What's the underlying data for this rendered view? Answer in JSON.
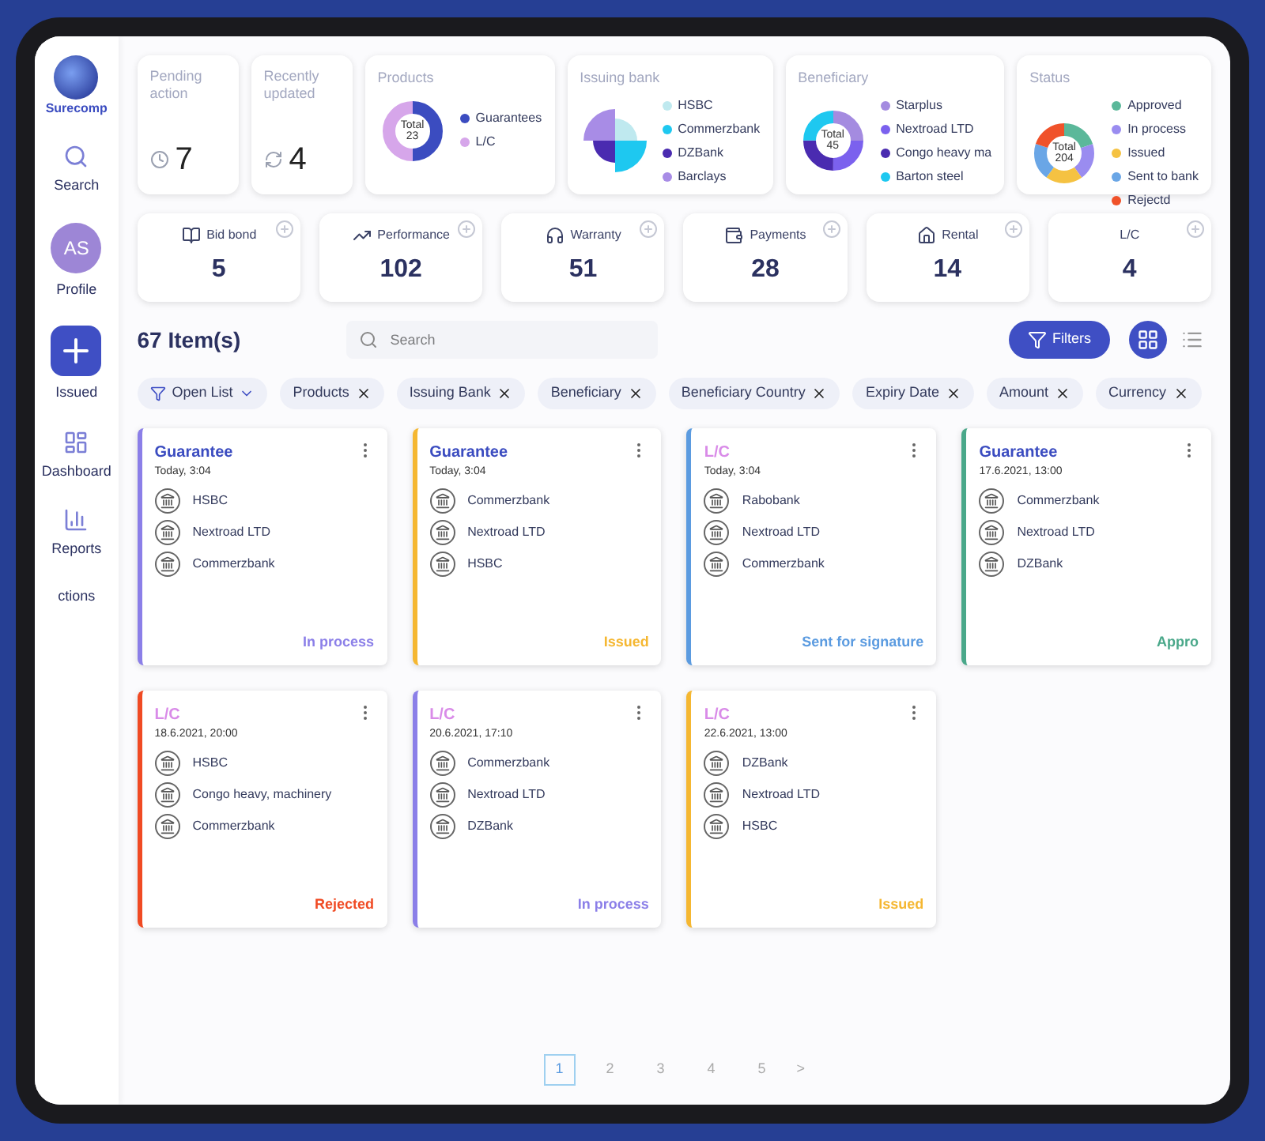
{
  "sidebar": {
    "logo": "Surecomp",
    "items": [
      {
        "kind": "search",
        "label": "Search"
      },
      {
        "kind": "avatar",
        "label": "Profile",
        "initials": "AS"
      },
      {
        "kind": "add",
        "label": "Issued"
      },
      {
        "kind": "dashboard",
        "label": "Dashboard"
      },
      {
        "kind": "reports",
        "label": "Reports"
      },
      {
        "kind": "plain",
        "label": "ctions"
      }
    ]
  },
  "summary": [
    {
      "kind": "pending",
      "title": "Pending action",
      "value": "7"
    },
    {
      "kind": "recent",
      "title": "Recently updated",
      "value": "4"
    },
    {
      "kind": "donut",
      "title": "Products",
      "total_label": "Total",
      "total": "23",
      "legend": [
        {
          "label": "Guarantees",
          "color": "#3b4cc0"
        },
        {
          "label": "L/C",
          "color": "#d6a6ea"
        }
      ]
    },
    {
      "kind": "pie",
      "title": "Issuing bank",
      "legend": [
        {
          "label": "HSBC",
          "color": "#bfe9ef"
        },
        {
          "label": "Commerzbank",
          "color": "#1ec8f0"
        },
        {
          "label": "DZBank",
          "color": "#4a2bb0"
        },
        {
          "label": "Barclays",
          "color": "#a88ce6"
        }
      ]
    },
    {
      "kind": "donut",
      "title": "Beneficiary",
      "total_label": "Total",
      "total": "45",
      "legend": [
        {
          "label": "Starplus",
          "color": "#a48be0"
        },
        {
          "label": "Nextroad LTD",
          "color": "#7b61ee"
        },
        {
          "label": "Congo heavy ma",
          "color": "#4a2bb0"
        },
        {
          "label": "Barton steel",
          "color": "#1ec8f0"
        }
      ]
    },
    {
      "kind": "donut",
      "title": "Status",
      "total_label": "Total",
      "total": "204",
      "legend": [
        {
          "label": "Approved",
          "color": "#5bb89a"
        },
        {
          "label": "In process",
          "color": "#9a8cf0"
        },
        {
          "label": "Issued",
          "color": "#f5c242"
        },
        {
          "label": "Sent to bank",
          "color": "#6aa6e6"
        },
        {
          "label": "Rejectd",
          "color": "#f0522a"
        }
      ]
    }
  ],
  "counters": [
    {
      "kind": "bid_bond",
      "label": "Bid bond",
      "value": "5"
    },
    {
      "kind": "performance",
      "label": "Performance",
      "value": "102"
    },
    {
      "kind": "warranty",
      "label": "Warranty",
      "value": "51"
    },
    {
      "kind": "payments",
      "label": "Payments",
      "value": "28"
    },
    {
      "kind": "rental",
      "label": "Rental",
      "value": "14"
    },
    {
      "kind": "none",
      "label": "L/C",
      "value": "4"
    }
  ],
  "toolbar": {
    "count": "67 Item(s)",
    "search": {
      "placeholder": "Search"
    },
    "filters": "Filters",
    "views": [
      {
        "kind": "grid",
        "selected": true
      },
      {
        "kind": "list",
        "selected": false
      }
    ]
  },
  "chips": [
    {
      "kind": "dropdown",
      "label": "Open List"
    },
    {
      "kind": "removable",
      "label": "Products"
    },
    {
      "kind": "removable",
      "label": "Issuing Bank"
    },
    {
      "kind": "removable",
      "label": "Beneficiary"
    },
    {
      "kind": "removable",
      "label": "Beneficiary Country"
    },
    {
      "kind": "removable",
      "label": "Expiry Date"
    },
    {
      "kind": "removable",
      "label": "Amount"
    },
    {
      "kind": "removable",
      "label": "Currency"
    }
  ],
  "cards": [
    {
      "kind": "guarantee",
      "type": "Guarantee",
      "date": "Today, 3:04",
      "parties": [
        "HSBC",
        "Nextroad LTD",
        "Commerzbank"
      ],
      "status": "In process",
      "color": "#8b7fe8"
    },
    {
      "kind": "guarantee",
      "type": "Guarantee",
      "date": "Today, 3:04",
      "parties": [
        "Commerzbank",
        "Nextroad LTD",
        "HSBC"
      ],
      "status": "Issued",
      "color": "#f5b731"
    },
    {
      "kind": "lc",
      "type": "L/C",
      "date": "Today, 3:04",
      "parties": [
        "Rabobank",
        "Nextroad LTD",
        "Commerzbank"
      ],
      "status": "Sent for signature",
      "color": "#5b9be0"
    },
    {
      "kind": "guarantee",
      "type": "Guarantee",
      "date": "17.6.2021, 13:00",
      "parties": [
        "Commerzbank",
        "Nextroad LTD",
        "DZBank"
      ],
      "status": "Appro",
      "color": "#4aa88a"
    },
    {
      "kind": "lc",
      "type": "L/C",
      "date": "18.6.2021, 20:00",
      "parties": [
        "HSBC",
        "Congo heavy, machinery",
        "Commerzbank"
      ],
      "status": "Rejected",
      "color": "#f04a23"
    },
    {
      "kind": "lc",
      "type": "L/C",
      "date": "20.6.2021, 17:10",
      "parties": [
        "Commerzbank",
        "Nextroad LTD",
        "DZBank"
      ],
      "status": "In process",
      "color": "#8b7fe8"
    },
    {
      "kind": "lc",
      "type": "L/C",
      "date": "22.6.2021, 13:00",
      "parties": [
        "DZBank",
        "Nextroad LTD",
        "HSBC"
      ],
      "status": "Issued",
      "color": "#f5b731"
    }
  ],
  "pagination": {
    "pages": [
      {
        "label": "1",
        "selected": true
      },
      {
        "label": "2",
        "selected": false
      },
      {
        "label": "3",
        "selected": false
      },
      {
        "label": "4",
        "selected": false
      },
      {
        "label": "5",
        "selected": false
      }
    ],
    "next": ">"
  }
}
